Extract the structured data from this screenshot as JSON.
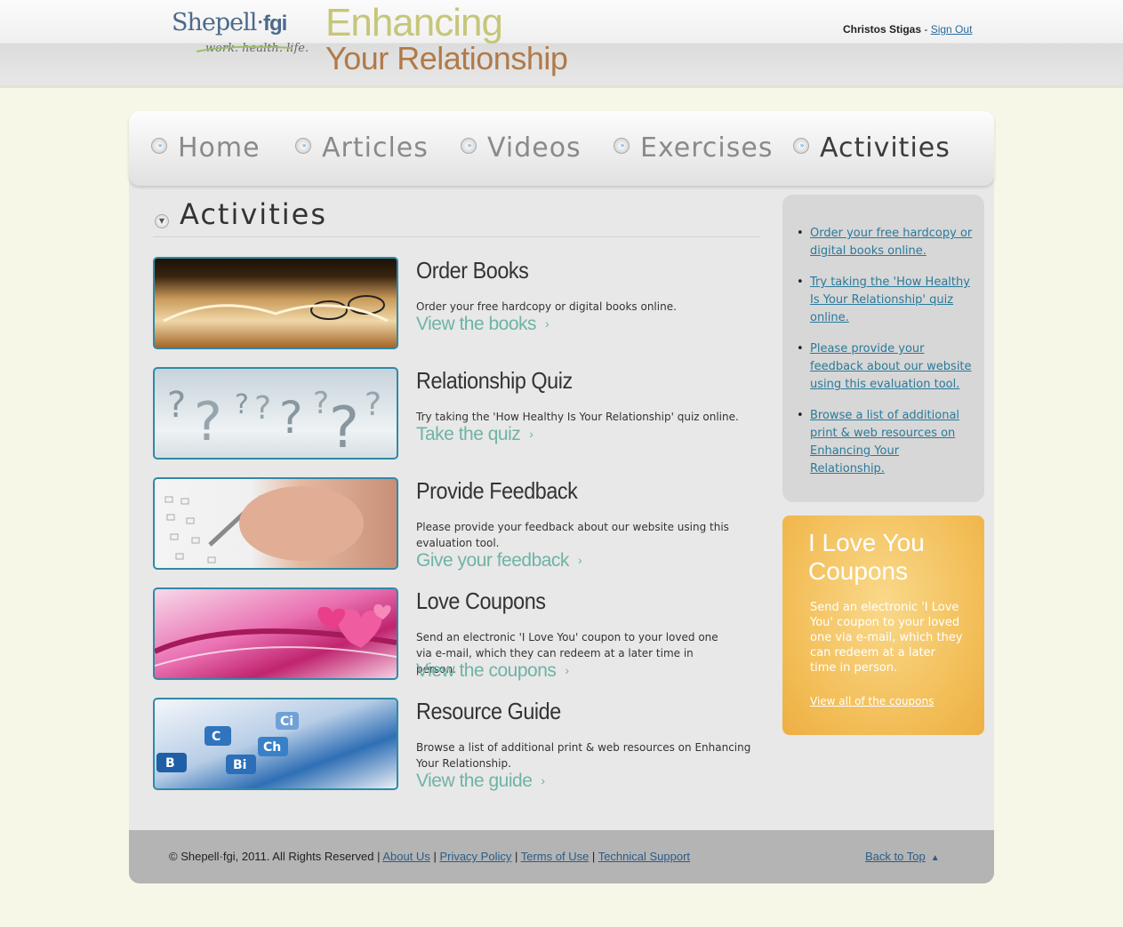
{
  "header": {
    "logo_main": "Shepell·",
    "logo_bold": "fgi",
    "logo_sub": "work. health. life.",
    "title_line1": "Enhancing",
    "title_line2": "Your Relationship",
    "user_name": "Christos Stigas",
    "separator": " - ",
    "sign_out": "Sign Out"
  },
  "nav": {
    "items": [
      {
        "label": "Home"
      },
      {
        "label": "Articles"
      },
      {
        "label": "Videos"
      },
      {
        "label": "Exercises"
      },
      {
        "label": "Activities"
      }
    ],
    "active": "Activities"
  },
  "main": {
    "section_title": "Activities",
    "items": [
      {
        "title": "Order Books",
        "desc": "Order your free hardcopy or digital books online.",
        "link": "View the books"
      },
      {
        "title": "Relationship Quiz",
        "desc": "Try taking the 'How Healthy Is Your Relationship' quiz online.",
        "link": "Take the quiz"
      },
      {
        "title": "Provide Feedback",
        "desc": "Please provide your feedback about our website using this evaluation tool.",
        "link": "Give your feedback"
      },
      {
        "title": "Love Coupons",
        "desc": "Send an electronic 'I Love You' coupon to your loved one via e-mail, which they can redeem at a later time in person.",
        "link": "View the coupons"
      },
      {
        "title": "Resource Guide",
        "desc": "Browse a list of additional print & web resources on Enhancing Your Relationship.",
        "link": "View the guide"
      }
    ]
  },
  "sidebar": {
    "links": [
      "Order your free hardcopy or digital books online.",
      "Try taking the 'How Healthy Is Your Relationship' quiz online.",
      "Please provide your feedback about our website using this evaluation tool.",
      "Browse a list of additional print & web resources on Enhancing Your Relationship."
    ],
    "promo_title": "I Love You Coupons",
    "promo_text": "Send an electronic 'I Love You' coupon to your loved one via e-mail, which they can redeem at a later time in person.",
    "promo_link": "View all of the coupons"
  },
  "footer": {
    "copyright": "© Shepell·fgi, 2011. All Rights Reserved | ",
    "about": "About Us",
    "privacy": "Privacy Policy",
    "terms": "Terms of Use",
    "support": "Technical Support",
    "sep": " | ",
    "back_to_top": "Back to Top"
  },
  "colors": {
    "accent_link": "#2a7a9a",
    "teal_link": "#6fb3a5",
    "promo_bg": "#f2bc55",
    "thumb_border": "#2f8aa6"
  },
  "icons": {
    "nav_bullet": "double-chevron-icon",
    "section_bullet": "chevron-down-icon",
    "item_arrow": "chevron-right-icon",
    "back_to_top": "chevron-up-icon"
  }
}
